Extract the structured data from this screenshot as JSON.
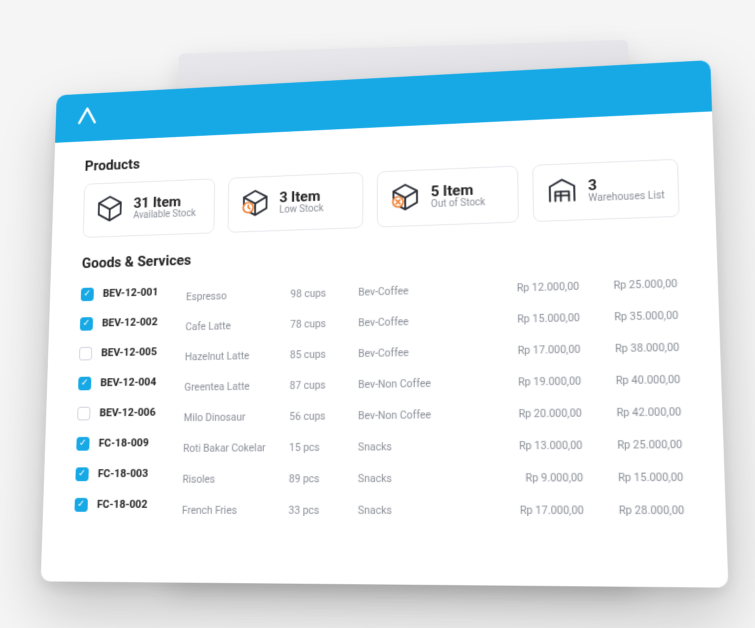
{
  "section_products_title": "Products",
  "cards": [
    {
      "big": "31 Item",
      "small": "Available Stock",
      "icon": "box"
    },
    {
      "big": "3 Item",
      "small": "Low Stock",
      "icon": "box-clock"
    },
    {
      "big": "5 Item",
      "small": "Out of Stock",
      "icon": "box-x"
    },
    {
      "big": "3",
      "small": "Warehouses List",
      "icon": "warehouse"
    }
  ],
  "section_goods_title": "Goods & Services",
  "rows": [
    {
      "checked": true,
      "sku": "BEV-12-001",
      "name": "Espresso",
      "qty": "98 cups",
      "cat": "Bev-Coffee",
      "p1": "Rp 12.000,00",
      "p2": "Rp 25.000,00"
    },
    {
      "checked": true,
      "sku": "BEV-12-002",
      "name": "Cafe Latte",
      "qty": "78 cups",
      "cat": "Bev-Coffee",
      "p1": "Rp 15.000,00",
      "p2": "Rp 35.000,00"
    },
    {
      "checked": false,
      "sku": "BEV-12-005",
      "name": "Hazelnut Latte",
      "qty": "85 cups",
      "cat": "Bev-Coffee",
      "p1": "Rp 17.000,00",
      "p2": "Rp 38.000,00"
    },
    {
      "checked": true,
      "sku": "BEV-12-004",
      "name": "Greentea Latte",
      "qty": "87 cups",
      "cat": "Bev-Non Coffee",
      "p1": "Rp 19.000,00",
      "p2": "Rp 40.000,00"
    },
    {
      "checked": false,
      "sku": "BEV-12-006",
      "name": "Milo Dinosaur",
      "qty": "56 cups",
      "cat": "Bev-Non Coffee",
      "p1": "Rp 20.000,00",
      "p2": "Rp 42.000,00"
    },
    {
      "checked": true,
      "sku": "FC-18-009",
      "name": "Roti Bakar Cokelar",
      "qty": "15 pcs",
      "cat": "Snacks",
      "p1": "Rp 13.000,00",
      "p2": "Rp 25.000,00"
    },
    {
      "checked": true,
      "sku": "FC-18-003",
      "name": "Risoles",
      "qty": "89 pcs",
      "cat": "Snacks",
      "p1": "Rp 9.000,00",
      "p2": "Rp 15.000,00"
    },
    {
      "checked": true,
      "sku": "FC-18-002",
      "name": "French Fries",
      "qty": "33 pcs",
      "cat": "Snacks",
      "p1": "Rp 17.000,00",
      "p2": "Rp 28.000,00"
    }
  ]
}
